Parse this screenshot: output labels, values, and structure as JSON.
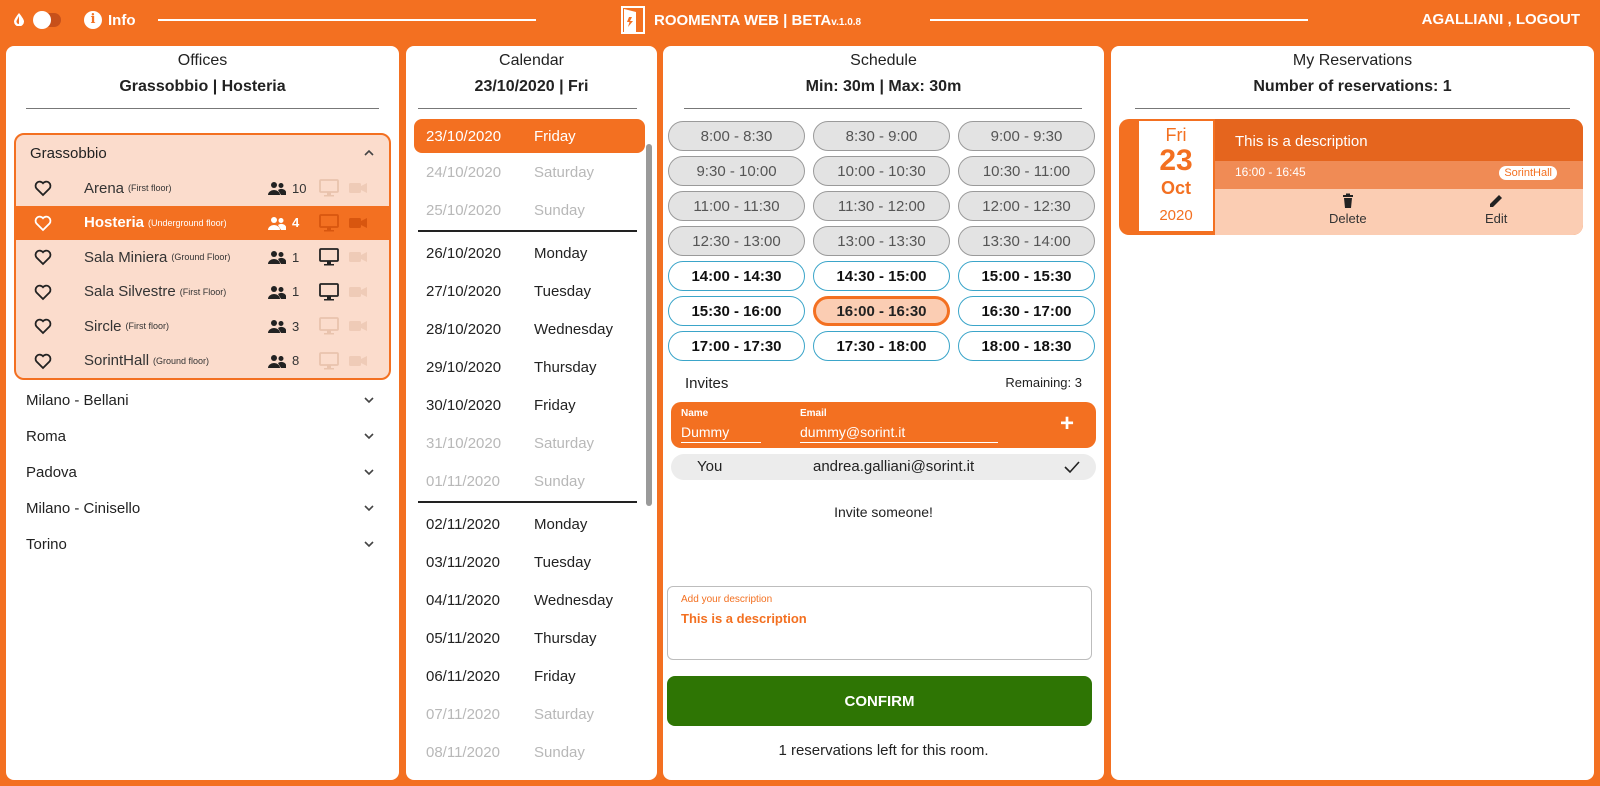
{
  "topbar": {
    "info_label": "Info",
    "brand": "ROOMENTA WEB | BETA",
    "version": "v.1.0.8",
    "user": "AGALLIANI",
    "separator": " , ",
    "logout": "LOGOUT"
  },
  "offices": {
    "title": "Offices",
    "subtitle": "Grassobbio | Hosteria",
    "open_group": {
      "name": "Grassobbio",
      "rooms": [
        {
          "name": "Arena",
          "floor": "(First floor)",
          "capacity": "10",
          "monitor": false,
          "selected": false
        },
        {
          "name": "Hosteria",
          "floor": "(Underground floor)",
          "capacity": "4",
          "monitor": false,
          "selected": true
        },
        {
          "name": "Sala Miniera",
          "floor": "(Ground Floor)",
          "capacity": "1",
          "monitor": true,
          "selected": false
        },
        {
          "name": "Sala Silvestre",
          "floor": "(First Floor)",
          "capacity": "1",
          "monitor": true,
          "selected": false
        },
        {
          "name": "Sircle",
          "floor": "(First floor)",
          "capacity": "3",
          "monitor": false,
          "selected": false
        },
        {
          "name": "SorintHall",
          "floor": "(Ground floor)",
          "capacity": "8",
          "monitor": false,
          "selected": false
        }
      ]
    },
    "groups": [
      "Milano - Bellani",
      "Roma",
      "Padova",
      "Milano - Cinisello",
      "Torino"
    ]
  },
  "calendar": {
    "title": "Calendar",
    "subtitle": "23/10/2020 | Fri",
    "days": [
      {
        "date": "23/10/2020",
        "day": "Friday",
        "kind": "sel"
      },
      {
        "date": "24/10/2020",
        "day": "Saturday",
        "kind": "weekend"
      },
      {
        "date": "25/10/2020",
        "day": "Sunday",
        "kind": "weekend"
      },
      {
        "date": "26/10/2020",
        "day": "Monday",
        "kind": "normal"
      },
      {
        "date": "27/10/2020",
        "day": "Tuesday",
        "kind": "normal"
      },
      {
        "date": "28/10/2020",
        "day": "Wednesday",
        "kind": "normal"
      },
      {
        "date": "29/10/2020",
        "day": "Thursday",
        "kind": "normal"
      },
      {
        "date": "30/10/2020",
        "day": "Friday",
        "kind": "normal"
      },
      {
        "date": "31/10/2020",
        "day": "Saturday",
        "kind": "weekend"
      },
      {
        "date": "01/11/2020",
        "day": "Sunday",
        "kind": "weekend"
      },
      {
        "date": "02/11/2020",
        "day": "Monday",
        "kind": "normal"
      },
      {
        "date": "03/11/2020",
        "day": "Tuesday",
        "kind": "normal"
      },
      {
        "date": "04/11/2020",
        "day": "Wednesday",
        "kind": "normal"
      },
      {
        "date": "05/11/2020",
        "day": "Thursday",
        "kind": "normal"
      },
      {
        "date": "06/11/2020",
        "day": "Friday",
        "kind": "normal"
      },
      {
        "date": "07/11/2020",
        "day": "Saturday",
        "kind": "weekend"
      },
      {
        "date": "08/11/2020",
        "day": "Sunday",
        "kind": "weekend"
      }
    ]
  },
  "schedule": {
    "title": "Schedule",
    "subtitle": "Min: 30m | Max: 30m",
    "slots": [
      {
        "label": "8:00 - 8:30",
        "state": "past"
      },
      {
        "label": "8:30 - 9:00",
        "state": "past"
      },
      {
        "label": "9:00 - 9:30",
        "state": "past"
      },
      {
        "label": "9:30 - 10:00",
        "state": "past"
      },
      {
        "label": "10:00 - 10:30",
        "state": "past"
      },
      {
        "label": "10:30 - 11:00",
        "state": "past"
      },
      {
        "label": "11:00 - 11:30",
        "state": "past"
      },
      {
        "label": "11:30 - 12:00",
        "state": "past"
      },
      {
        "label": "12:00 - 12:30",
        "state": "past"
      },
      {
        "label": "12:30 - 13:00",
        "state": "past"
      },
      {
        "label": "13:00 - 13:30",
        "state": "past"
      },
      {
        "label": "13:30 - 14:00",
        "state": "past"
      },
      {
        "label": "14:00 - 14:30",
        "state": "free"
      },
      {
        "label": "14:30 - 15:00",
        "state": "free"
      },
      {
        "label": "15:00 - 15:30",
        "state": "free"
      },
      {
        "label": "15:30 - 16:00",
        "state": "free"
      },
      {
        "label": "16:00 - 16:30",
        "state": "sel"
      },
      {
        "label": "16:30 - 17:00",
        "state": "free"
      },
      {
        "label": "17:00 - 17:30",
        "state": "free"
      },
      {
        "label": "17:30 - 18:00",
        "state": "free"
      },
      {
        "label": "18:00 - 18:30",
        "state": "free"
      }
    ],
    "invites_label": "Invites",
    "remaining": "Remaining: 3",
    "form": {
      "name_label": "Name",
      "name_value": "Dummy",
      "email_label": "Email",
      "email_value": "dummy@sorint.it",
      "add": "+"
    },
    "you": {
      "name": "You",
      "email": "andrea.galliani@sorint.it"
    },
    "invite_someone": "Invite someone!",
    "desc_label": "Add your description",
    "desc_value": "This is a description",
    "confirm": "CONFIRM",
    "left_note": "1 reservations left for this room."
  },
  "reservations": {
    "title": "My Reservations",
    "subtitle": "Number of reservations: 1",
    "card": {
      "weekday": "Fri",
      "day": "23",
      "month": "Oct",
      "year": "2020",
      "description": "This is a description",
      "time": "16:00 - 16:45",
      "room": "SorintHall",
      "delete": "Delete",
      "edit": "Edit"
    }
  },
  "colors": {
    "accent": "#f37021",
    "confirm": "#2e7504",
    "free_border": "#3ba5c9"
  }
}
